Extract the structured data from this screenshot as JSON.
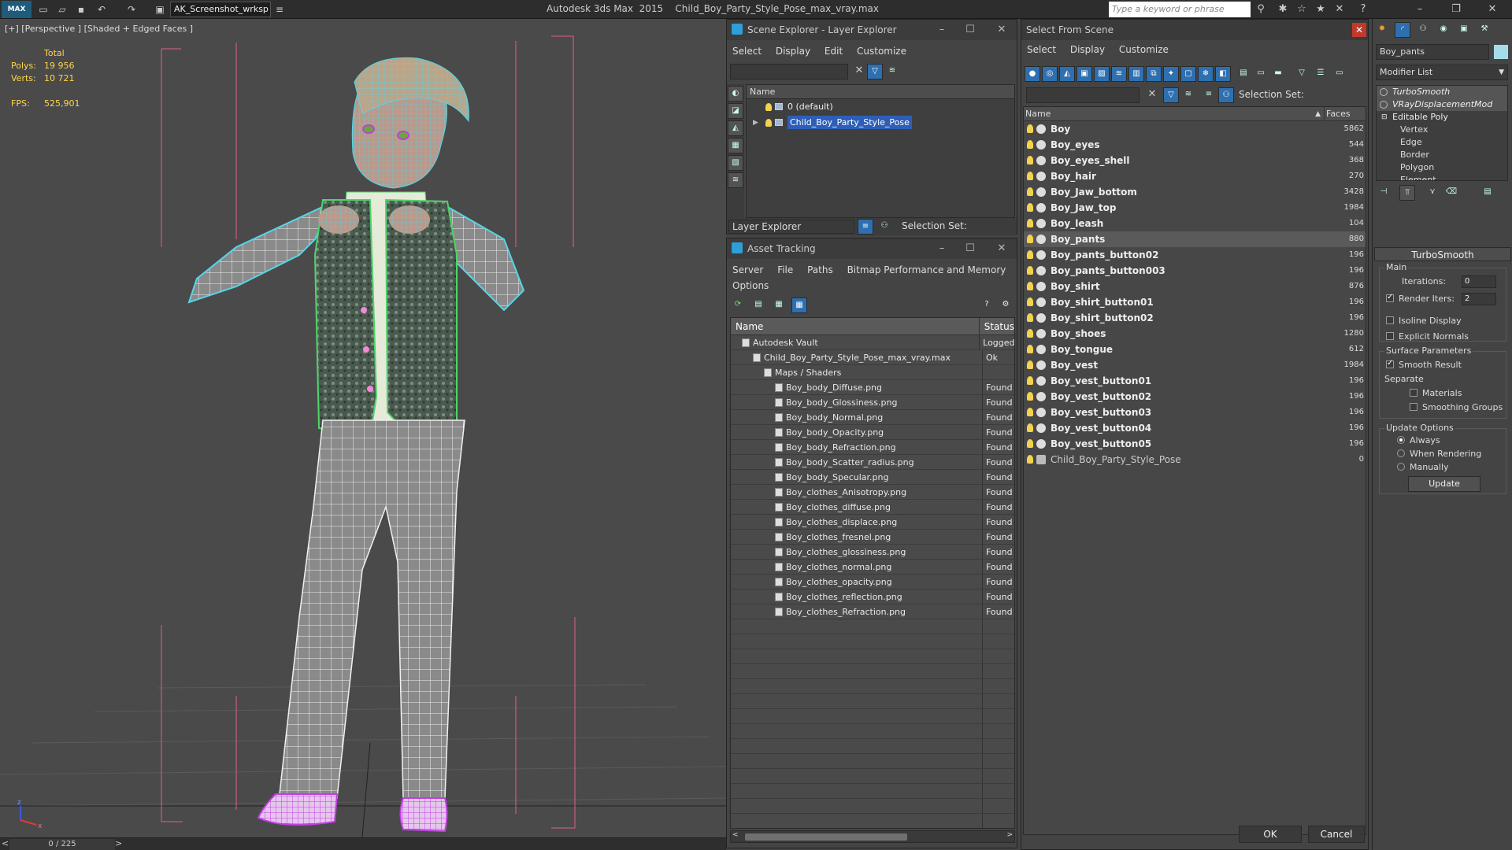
{
  "app": {
    "logo": "MAX",
    "workspace": "AK_Screenshot_wrksp",
    "title": "Autodesk 3ds Max  2015    Child_Boy_Party_Style_Pose_max_vray.max",
    "search_placeholder": "Type a keyword or phrase"
  },
  "viewport": {
    "label": "[+] [Perspective ] [Shaded + Edged Faces ]",
    "stats": {
      "total_label": "Total",
      "polys_label": "Polys:",
      "polys_value": "19 956",
      "verts_label": "Verts:",
      "verts_value": "10 721",
      "fps_label": "FPS:",
      "fps_value": "525,901"
    },
    "frame_counter": "0 / 225",
    "axis_z": "z",
    "axis_x": "x"
  },
  "scene_explorer": {
    "title": "Scene Explorer - Layer Explorer",
    "menu": [
      "Select",
      "Display",
      "Edit",
      "Customize"
    ],
    "column": "Name",
    "layers": [
      {
        "name": "0 (default)",
        "selected": false
      },
      {
        "name": "Child_Boy_Party_Style_Pose",
        "selected": true
      }
    ],
    "explorer_dropdown": "Layer Explorer",
    "selection_set_label": "Selection Set:"
  },
  "asset_tracking": {
    "title": "Asset Tracking",
    "menu": [
      "Server",
      "File",
      "Paths",
      "Bitmap Performance and Memory",
      "Options"
    ],
    "columns": [
      "Name",
      "Status"
    ],
    "rows": [
      {
        "name": "Autodesk Vault",
        "status": "Logged",
        "indent": 0
      },
      {
        "name": "Child_Boy_Party_Style_Pose_max_vray.max",
        "status": "Ok",
        "indent": 1
      },
      {
        "name": "Maps / Shaders",
        "status": "",
        "indent": 2
      },
      {
        "name": "Boy_body_Diffuse.png",
        "status": "Found",
        "indent": 3
      },
      {
        "name": "Boy_body_Glossiness.png",
        "status": "Found",
        "indent": 3
      },
      {
        "name": "Boy_body_Normal.png",
        "status": "Found",
        "indent": 3
      },
      {
        "name": "Boy_body_Opacity.png",
        "status": "Found",
        "indent": 3
      },
      {
        "name": "Boy_body_Refraction.png",
        "status": "Found",
        "indent": 3
      },
      {
        "name": "Boy_body_Scatter_radius.png",
        "status": "Found",
        "indent": 3
      },
      {
        "name": "Boy_body_Specular.png",
        "status": "Found",
        "indent": 3
      },
      {
        "name": "Boy_clothes_Anisotropy.png",
        "status": "Found",
        "indent": 3
      },
      {
        "name": "Boy_clothes_diffuse.png",
        "status": "Found",
        "indent": 3
      },
      {
        "name": "Boy_clothes_displace.png",
        "status": "Found",
        "indent": 3
      },
      {
        "name": "Boy_clothes_fresnel.png",
        "status": "Found",
        "indent": 3
      },
      {
        "name": "Boy_clothes_glossiness.png",
        "status": "Found",
        "indent": 3
      },
      {
        "name": "Boy_clothes_normal.png",
        "status": "Found",
        "indent": 3
      },
      {
        "name": "Boy_clothes_opacity.png",
        "status": "Found",
        "indent": 3
      },
      {
        "name": "Boy_clothes_reflection.png",
        "status": "Found",
        "indent": 3
      },
      {
        "name": "Boy_clothes_Refraction.png",
        "status": "Found",
        "indent": 3
      }
    ]
  },
  "select_from_scene": {
    "title": "Select From Scene",
    "menu": [
      "Select",
      "Display",
      "Customize"
    ],
    "selection_set_label": "Selection Set:",
    "columns": [
      "Name",
      "Faces"
    ],
    "objects": [
      {
        "name": "Boy",
        "faces": "5862"
      },
      {
        "name": "Boy_eyes",
        "faces": "544"
      },
      {
        "name": "Boy_eyes_shell",
        "faces": "368"
      },
      {
        "name": "Boy_hair",
        "faces": "270"
      },
      {
        "name": "Boy_Jaw_bottom",
        "faces": "3428"
      },
      {
        "name": "Boy_Jaw_top",
        "faces": "1984"
      },
      {
        "name": "Boy_leash",
        "faces": "104"
      },
      {
        "name": "Boy_pants",
        "faces": "880",
        "selected": true
      },
      {
        "name": "Boy_pants_button02",
        "faces": "196"
      },
      {
        "name": "Boy_pants_button003",
        "faces": "196"
      },
      {
        "name": "Boy_shirt",
        "faces": "876"
      },
      {
        "name": "Boy_shirt_button01",
        "faces": "196"
      },
      {
        "name": "Boy_shirt_button02",
        "faces": "196"
      },
      {
        "name": "Boy_shoes",
        "faces": "1280"
      },
      {
        "name": "Boy_tongue",
        "faces": "612"
      },
      {
        "name": "Boy_vest",
        "faces": "1984"
      },
      {
        "name": "Boy_vest_button01",
        "faces": "196"
      },
      {
        "name": "Boy_vest_button02",
        "faces": "196"
      },
      {
        "name": "Boy_vest_button03",
        "faces": "196"
      },
      {
        "name": "Boy_vest_button04",
        "faces": "196"
      },
      {
        "name": "Boy_vest_button05",
        "faces": "196"
      },
      {
        "name": "Child_Boy_Party_Style_Pose",
        "faces": "0",
        "plain": true
      }
    ],
    "ok_label": "OK",
    "cancel_label": "Cancel"
  },
  "command_panel": {
    "object_name": "Boy_pants",
    "object_color": "#a6dcea",
    "modifier_list": "Modifier List",
    "stack": [
      {
        "label": "TurboSmooth",
        "type": "mod"
      },
      {
        "label": "VRayDisplacementMod",
        "type": "mod"
      },
      {
        "label": "Editable Poly",
        "type": "ep"
      },
      {
        "label": "Vertex",
        "type": "sub"
      },
      {
        "label": "Edge",
        "type": "sub"
      },
      {
        "label": "Border",
        "type": "sub"
      },
      {
        "label": "Polygon",
        "type": "sub"
      },
      {
        "label": "Element",
        "type": "sub"
      }
    ],
    "rollout_title": "TurboSmooth",
    "main_label": "Main",
    "iterations_label": "Iterations:",
    "iterations_value": "0",
    "render_iters_label": "Render Iters:",
    "render_iters_value": "2",
    "isoline_label": "Isoline Display",
    "explicit_normals_label": "Explicit Normals",
    "surface_label": "Surface Parameters",
    "smooth_result_label": "Smooth Result",
    "separate_label": "Separate",
    "materials_label": "Materials",
    "smoothing_groups_label": "Smoothing Groups",
    "update_options_label": "Update Options",
    "always_label": "Always",
    "when_rendering_label": "When Rendering",
    "manually_label": "Manually",
    "update_button": "Update"
  },
  "colors": {
    "accent": "#2e6fb0",
    "selection": "#2e5fb8",
    "stats_text": "#ffd54a",
    "bulb": "#f3d24f",
    "wire_cyan": "#55d6e8",
    "wire_green": "#4fd46a",
    "wire_magenta": "#c040e0",
    "bbox_pink": "#e0608a"
  }
}
